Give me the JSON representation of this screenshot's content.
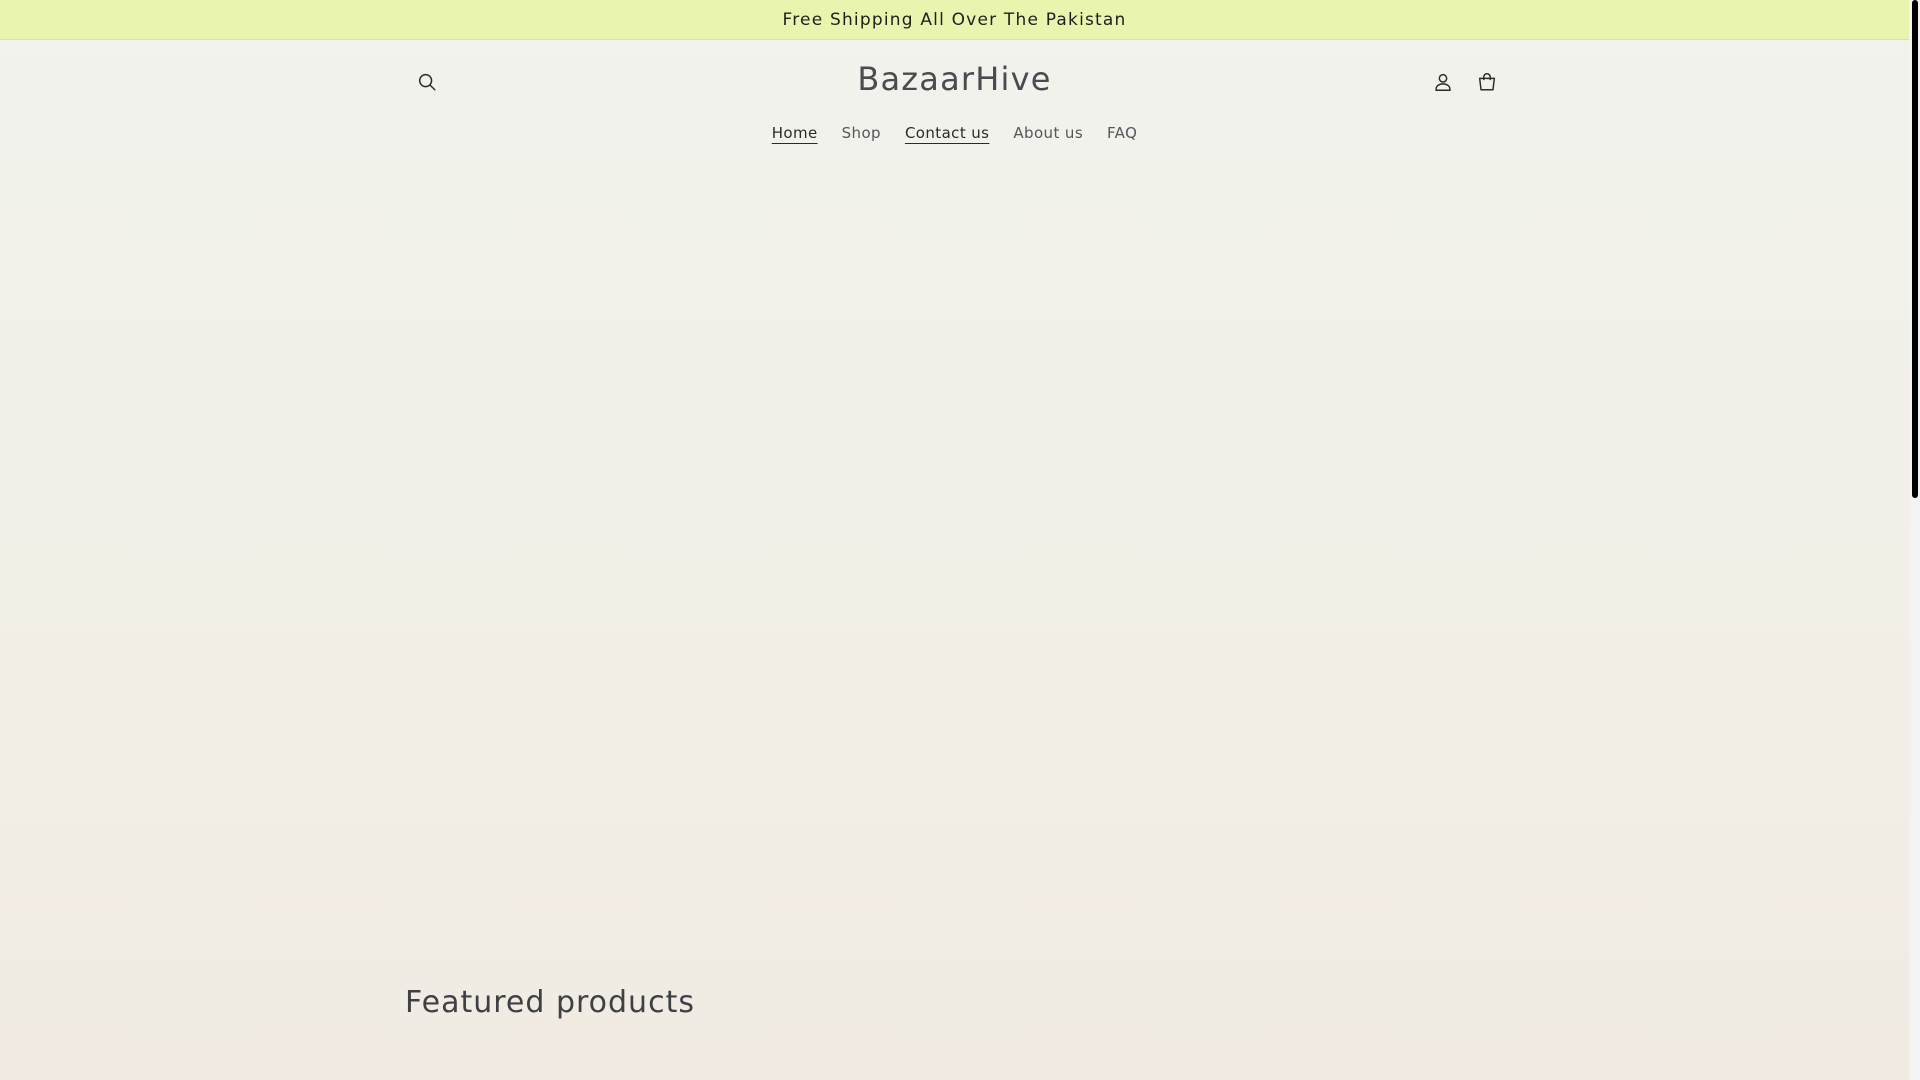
{
  "announcement": {
    "text": "Free Shipping All Over The Pakistan"
  },
  "header": {
    "logo": "BazaarHive",
    "icons": {
      "search": "search-icon",
      "account": "account-icon",
      "cart": "cart-icon"
    }
  },
  "nav": {
    "items": [
      {
        "label": "Home",
        "active": true
      },
      {
        "label": "Shop",
        "active": false
      },
      {
        "label": "Contact us",
        "active": true
      },
      {
        "label": "About us",
        "active": false
      },
      {
        "label": "FAQ",
        "active": false
      }
    ]
  },
  "main": {
    "featured_title": "Featured products"
  },
  "colors": {
    "announcement_bg": "#e9f4ae",
    "text": "#3f3f46"
  }
}
